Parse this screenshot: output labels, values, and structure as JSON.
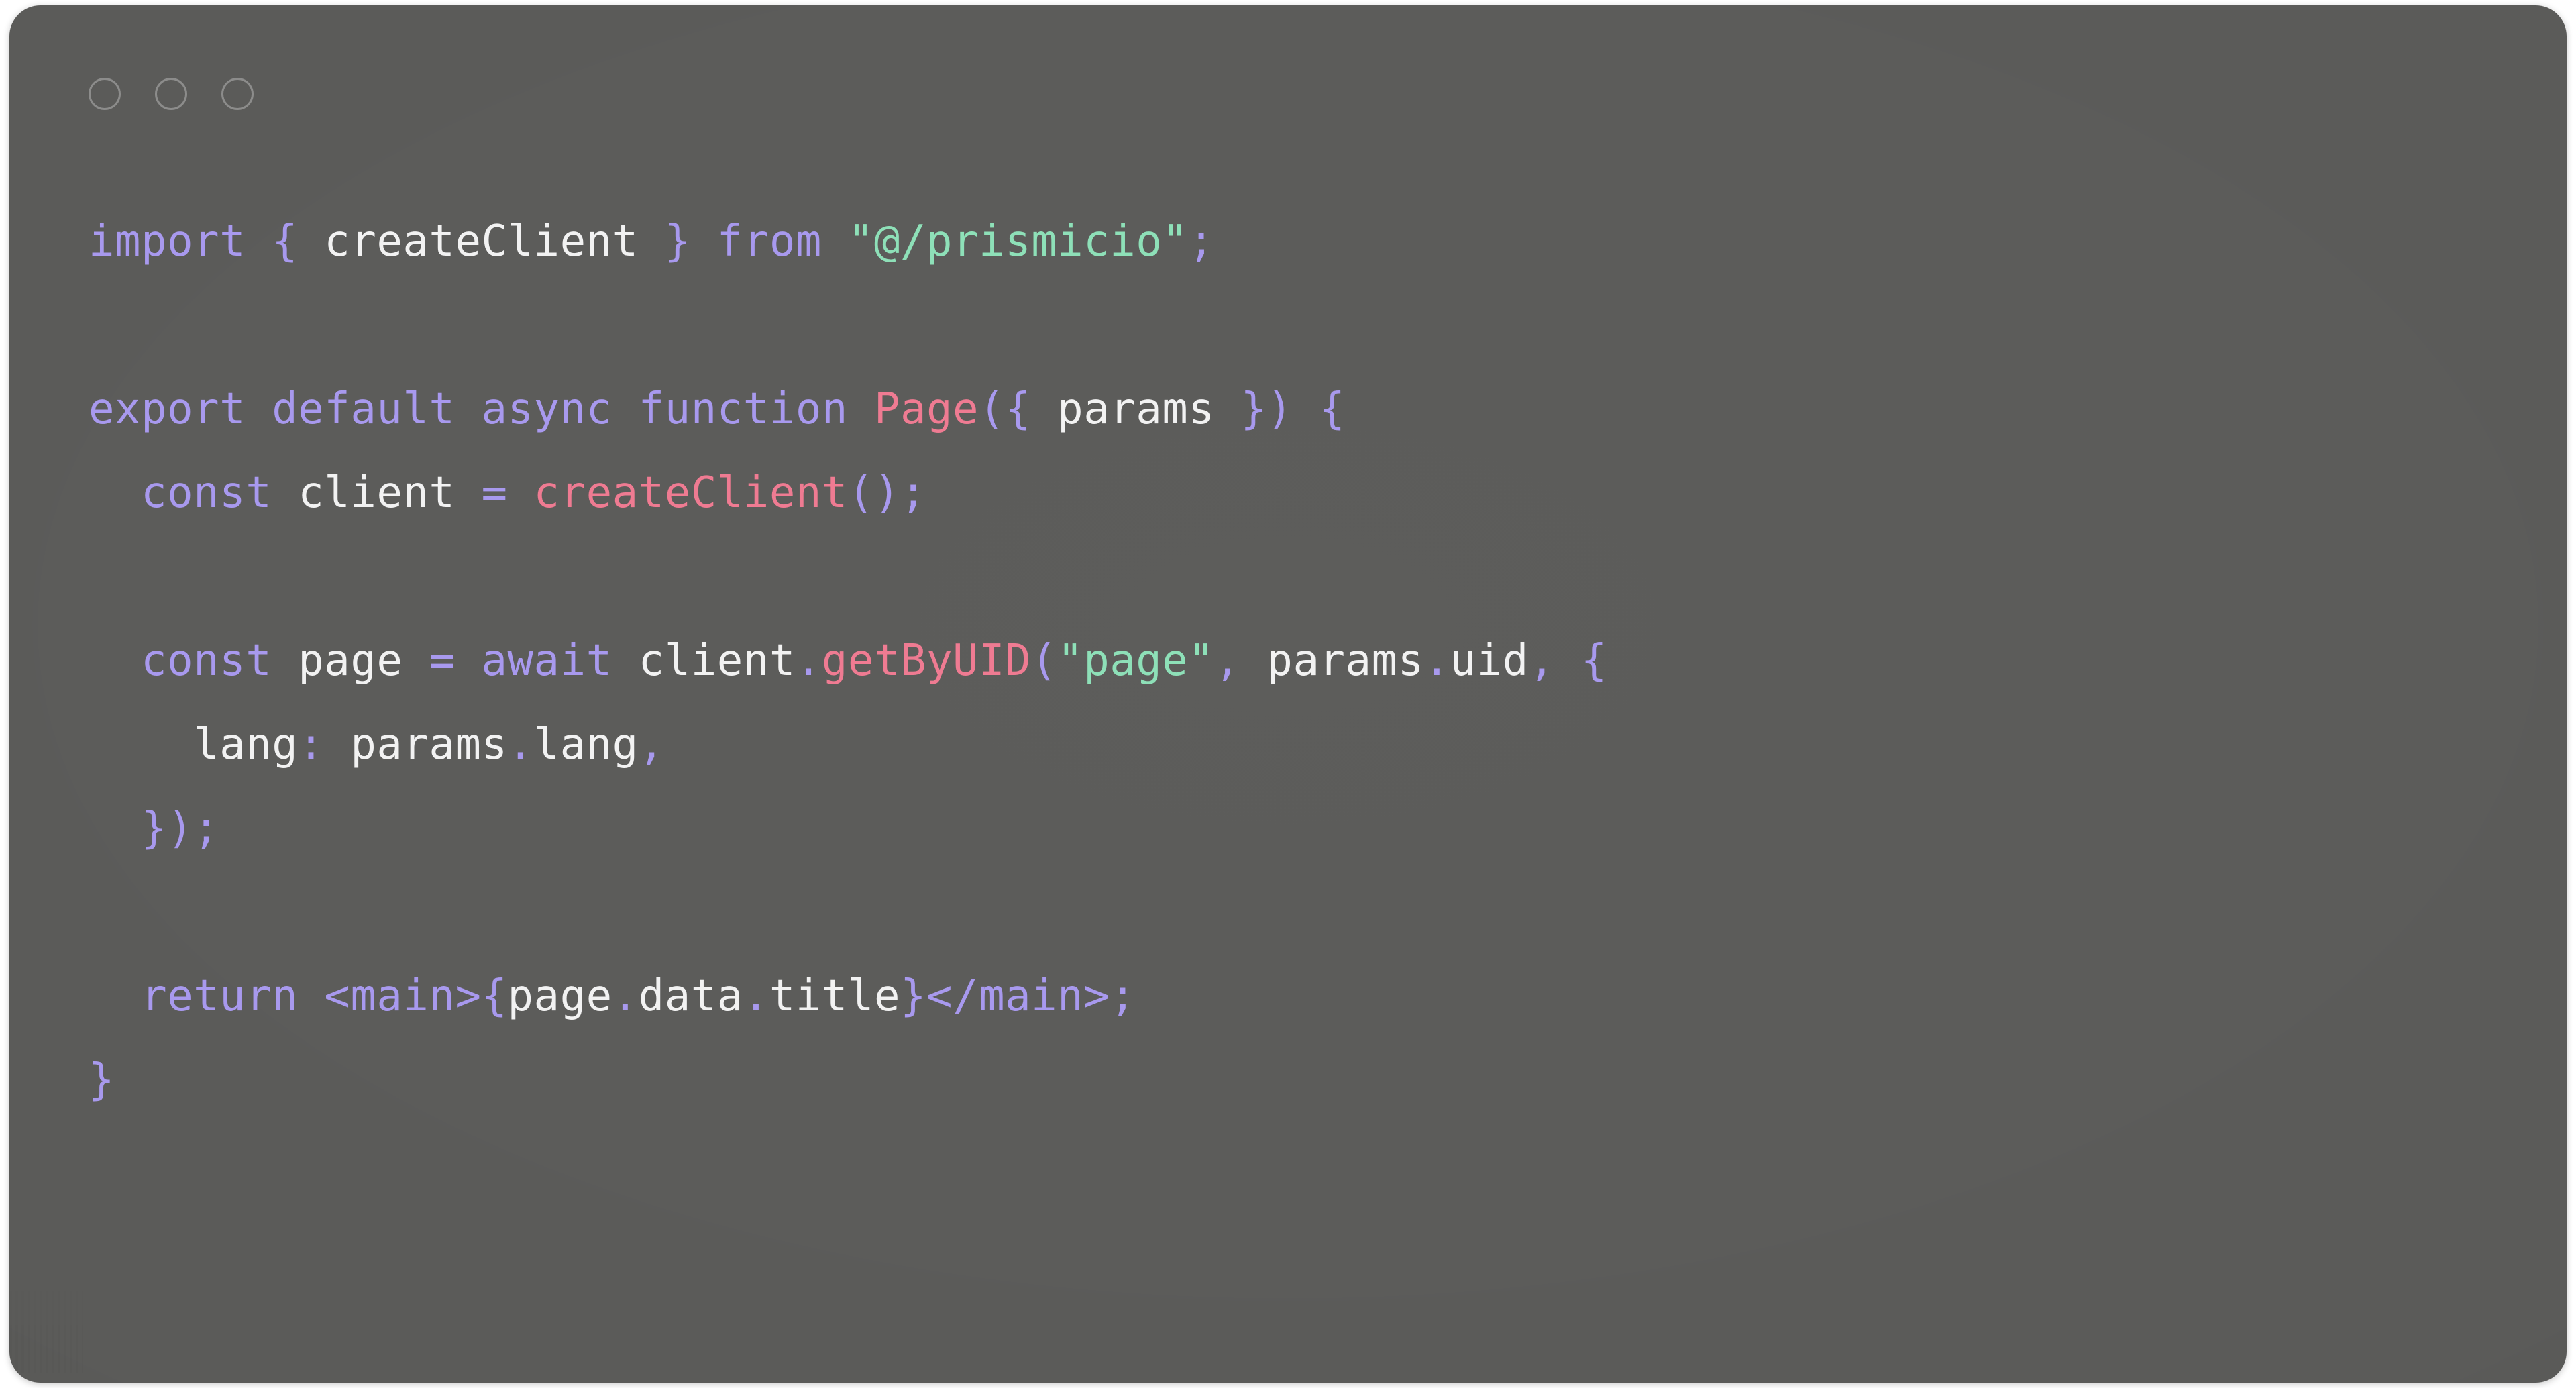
{
  "window": {
    "title": "",
    "traffic_lights": [
      {
        "name": "close-dot",
        "color": "#8f8f8d"
      },
      {
        "name": "minimize-dot",
        "color": "#8f8f8d"
      },
      {
        "name": "maximize-dot",
        "color": "#8f8f8d"
      }
    ],
    "background": "#5b5b59",
    "page_background": "#ffffff",
    "corner_radius_px": 46
  },
  "theme": {
    "name": "dark-grey-code-card",
    "keyword": "#a899ee",
    "punctuation": "#a899ee",
    "identifier": "#f2f2f2",
    "string": "#8ee0b8",
    "function": "#ef7b92",
    "background": "#5b5b59"
  },
  "code": {
    "language": "tsx",
    "raw": "import { createClient } from \"@/prismicio\";\n\nexport default async function Page({ params }) {\n  const client = createClient();\n\n  const page = await client.getByUID(\"page\", params.uid, {\n    lang: params.lang,\n  });\n\n  return <main>{page.data.title}</main>;\n}",
    "lines": [
      {
        "n": 1,
        "text": "import { createClient } from \"@/prismicio\";",
        "tokens": [
          {
            "t": "import",
            "c": "keyword"
          },
          {
            "t": " ",
            "c": "plain"
          },
          {
            "t": "{",
            "c": "punctuation"
          },
          {
            "t": " ",
            "c": "plain"
          },
          {
            "t": "createClient",
            "c": "identifier"
          },
          {
            "t": " ",
            "c": "plain"
          },
          {
            "t": "}",
            "c": "punctuation"
          },
          {
            "t": " ",
            "c": "plain"
          },
          {
            "t": "from",
            "c": "keyword"
          },
          {
            "t": " ",
            "c": "plain"
          },
          {
            "t": "\"@/prismicio\"",
            "c": "string"
          },
          {
            "t": ";",
            "c": "punctuation"
          }
        ]
      },
      {
        "n": 2,
        "text": "",
        "tokens": []
      },
      {
        "n": 3,
        "text": "export default async function Page({ params }) {",
        "tokens": [
          {
            "t": "export",
            "c": "keyword"
          },
          {
            "t": " ",
            "c": "plain"
          },
          {
            "t": "default",
            "c": "keyword"
          },
          {
            "t": " ",
            "c": "plain"
          },
          {
            "t": "async",
            "c": "keyword"
          },
          {
            "t": " ",
            "c": "plain"
          },
          {
            "t": "function",
            "c": "keyword"
          },
          {
            "t": " ",
            "c": "plain"
          },
          {
            "t": "Page",
            "c": "function"
          },
          {
            "t": "({",
            "c": "punctuation"
          },
          {
            "t": " ",
            "c": "plain"
          },
          {
            "t": "params",
            "c": "identifier"
          },
          {
            "t": " ",
            "c": "plain"
          },
          {
            "t": "})",
            "c": "punctuation"
          },
          {
            "t": " ",
            "c": "plain"
          },
          {
            "t": "{",
            "c": "punctuation"
          }
        ]
      },
      {
        "n": 4,
        "text": "  const client = createClient();",
        "tokens": [
          {
            "t": "  ",
            "c": "plain"
          },
          {
            "t": "const",
            "c": "keyword"
          },
          {
            "t": " ",
            "c": "plain"
          },
          {
            "t": "client",
            "c": "identifier"
          },
          {
            "t": " ",
            "c": "plain"
          },
          {
            "t": "=",
            "c": "punctuation"
          },
          {
            "t": " ",
            "c": "plain"
          },
          {
            "t": "createClient",
            "c": "function"
          },
          {
            "t": "();",
            "c": "punctuation"
          }
        ]
      },
      {
        "n": 5,
        "text": "",
        "tokens": []
      },
      {
        "n": 6,
        "text": "  const page = await client.getByUID(\"page\", params.uid, {",
        "tokens": [
          {
            "t": "  ",
            "c": "plain"
          },
          {
            "t": "const",
            "c": "keyword"
          },
          {
            "t": " ",
            "c": "plain"
          },
          {
            "t": "page",
            "c": "identifier"
          },
          {
            "t": " ",
            "c": "plain"
          },
          {
            "t": "=",
            "c": "punctuation"
          },
          {
            "t": " ",
            "c": "plain"
          },
          {
            "t": "await",
            "c": "keyword"
          },
          {
            "t": " ",
            "c": "plain"
          },
          {
            "t": "client",
            "c": "identifier"
          },
          {
            "t": ".",
            "c": "punctuation"
          },
          {
            "t": "getByUID",
            "c": "function"
          },
          {
            "t": "(",
            "c": "punctuation"
          },
          {
            "t": "\"page\"",
            "c": "string"
          },
          {
            "t": ",",
            "c": "punctuation"
          },
          {
            "t": " ",
            "c": "plain"
          },
          {
            "t": "params",
            "c": "identifier"
          },
          {
            "t": ".",
            "c": "punctuation"
          },
          {
            "t": "uid",
            "c": "identifier"
          },
          {
            "t": ",",
            "c": "punctuation"
          },
          {
            "t": " ",
            "c": "plain"
          },
          {
            "t": "{",
            "c": "punctuation"
          }
        ]
      },
      {
        "n": 7,
        "text": "    lang: params.lang,",
        "tokens": [
          {
            "t": "    ",
            "c": "plain"
          },
          {
            "t": "lang",
            "c": "identifier"
          },
          {
            "t": ":",
            "c": "punctuation"
          },
          {
            "t": " ",
            "c": "plain"
          },
          {
            "t": "params",
            "c": "identifier"
          },
          {
            "t": ".",
            "c": "punctuation"
          },
          {
            "t": "lang",
            "c": "identifier"
          },
          {
            "t": ",",
            "c": "punctuation"
          }
        ]
      },
      {
        "n": 8,
        "text": "  });",
        "tokens": [
          {
            "t": "  ",
            "c": "plain"
          },
          {
            "t": "});",
            "c": "punctuation"
          }
        ]
      },
      {
        "n": 9,
        "text": "",
        "tokens": []
      },
      {
        "n": 10,
        "text": "  return <main>{page.data.title}</main>;",
        "tokens": [
          {
            "t": "  ",
            "c": "plain"
          },
          {
            "t": "return",
            "c": "keyword"
          },
          {
            "t": " ",
            "c": "plain"
          },
          {
            "t": "<main>",
            "c": "keyword"
          },
          {
            "t": "{",
            "c": "punctuation"
          },
          {
            "t": "page",
            "c": "identifier"
          },
          {
            "t": ".",
            "c": "punctuation"
          },
          {
            "t": "data",
            "c": "identifier"
          },
          {
            "t": ".",
            "c": "punctuation"
          },
          {
            "t": "title",
            "c": "identifier"
          },
          {
            "t": "}",
            "c": "punctuation"
          },
          {
            "t": "</main>",
            "c": "keyword"
          },
          {
            "t": ";",
            "c": "punctuation"
          }
        ]
      },
      {
        "n": 11,
        "text": "}",
        "tokens": [
          {
            "t": "}",
            "c": "punctuation"
          }
        ]
      }
    ]
  }
}
